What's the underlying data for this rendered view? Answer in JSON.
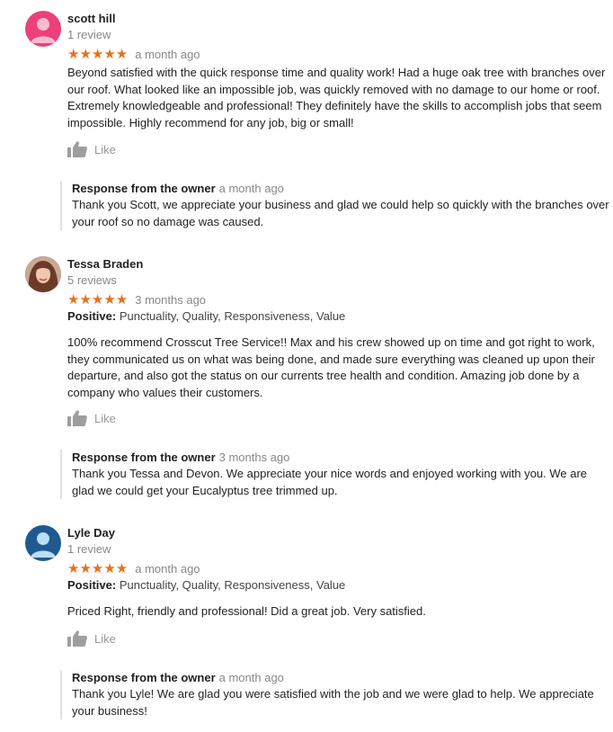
{
  "reviews": [
    {
      "name": "scott hill",
      "count": "1 review",
      "stars": "★★★★★",
      "date": "a month ago",
      "text": "Beyond satisfied with the quick response time and quality work! Had a huge oak tree with branches over our roof. What looked like an impossible job, was quickly removed with no damage to our home or roof. Extremely knowledgeable and professional! They definitely have the skills to accomplish jobs that seem impossible. Highly recommend for any job, big or small!",
      "like": "Like",
      "response_label": "Response from the owner",
      "response_date": "a month ago",
      "response_text": "Thank you Scott, we appreciate your business and glad we could help so quickly with the branches over your roof so no damage was caused.",
      "avatar_color": "#ec407a"
    },
    {
      "name": "Tessa Braden",
      "count": "5 reviews",
      "stars": "★★★★★",
      "date": "3 months ago",
      "positive_label": "Positive:",
      "positive_values": "Punctuality, Quality, Responsiveness, Value",
      "text": "100% recommend Crosscut Tree Service!! Max and his crew showed up on time and got right to work, they communicated us on what was being done, and made sure everything was cleaned up upon their departure, and also got the status on our currents tree health and condition. Amazing job done by a company who values their customers.",
      "like": "Like",
      "response_label": "Response from the owner",
      "response_date": "3 months ago",
      "response_text": "Thank you Tessa and Devon. We appreciate your nice words and enjoyed working with you. We are glad we could get your Eucalyptus tree trimmed up."
    },
    {
      "name": "Lyle Day",
      "count": "1 review",
      "stars": "★★★★★",
      "date": "a month ago",
      "positive_label": "Positive:",
      "positive_values": "Punctuality, Quality, Responsiveness, Value",
      "text": "Priced Right, friendly and professional!  Did a great job. Very satisfied.",
      "like": "Like",
      "response_label": "Response from the owner",
      "response_date": "a month ago",
      "response_text": "Thank you Lyle! We are glad you were satisfied with the job and we were glad to help. We appreciate your business!",
      "avatar_color": "#1e5a8f"
    }
  ]
}
